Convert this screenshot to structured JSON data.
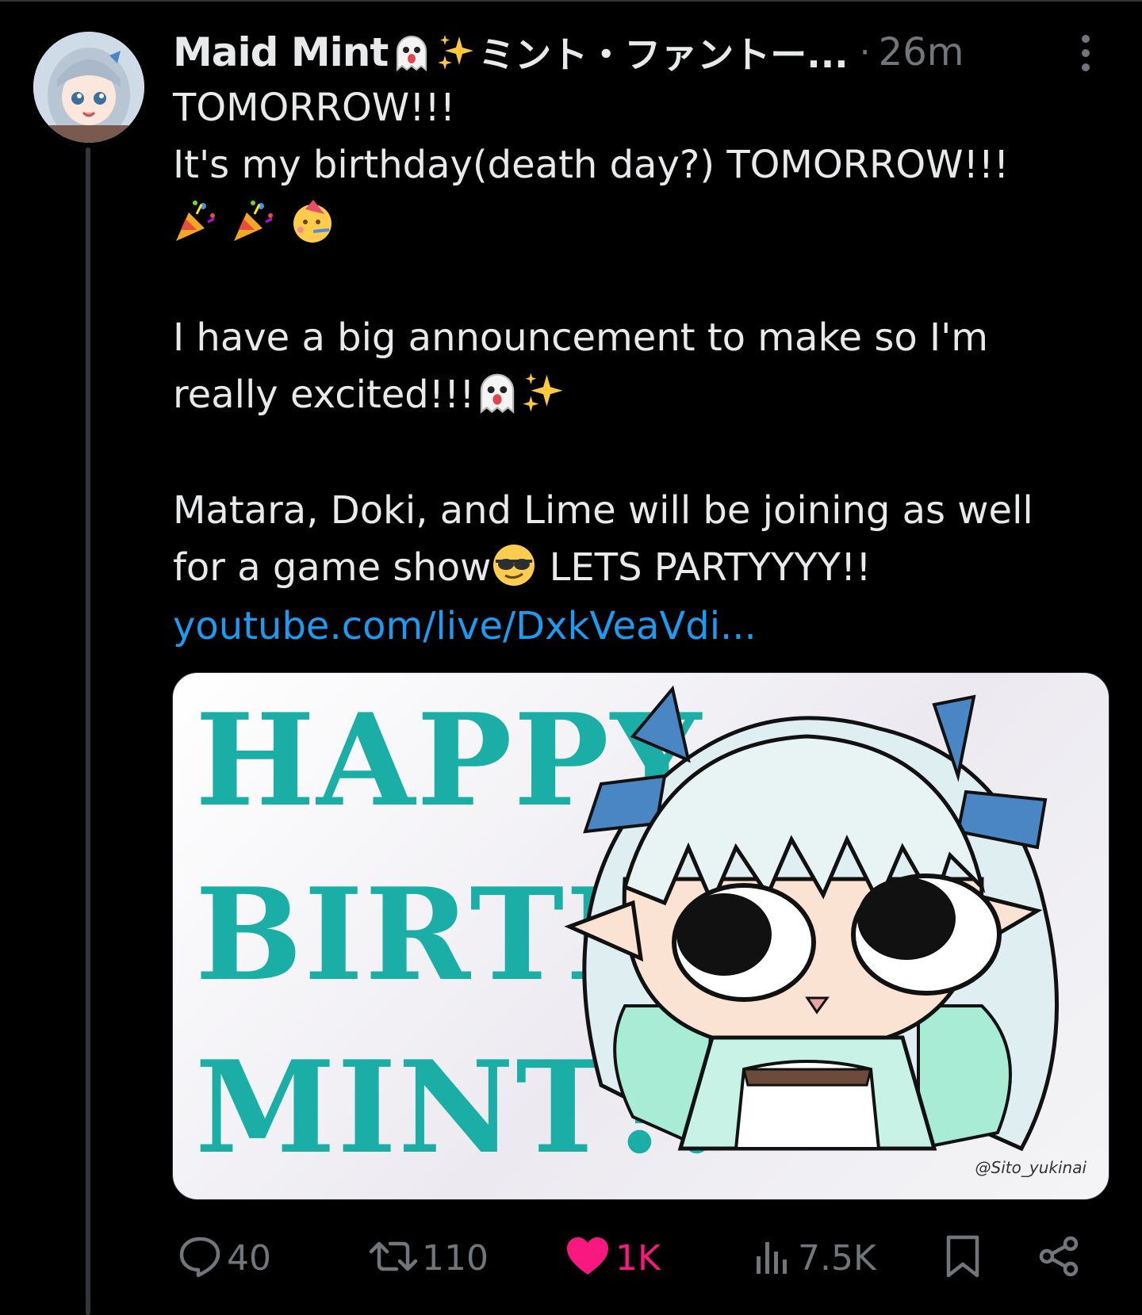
{
  "post": {
    "author_name": "Maid Mint",
    "author_name_jp": "ミント・ファントー...",
    "separator": "·",
    "time": "26m",
    "text_lines": [
      "TOMORROW!!!",
      "It's my birthday(death day?) TOMORROW!!!",
      "I have a big announcement to make so I'm",
      "really excited!!!",
      "Matara, Doki, and Lime will be joining as well",
      "for a game show",
      " LETS PARTYYYY!!"
    ],
    "link": "youtube.com/live/DxkVeaVdi...",
    "media": {
      "line1": "HAPPY",
      "line2": "BIRTH",
      "line3": "MINT!!",
      "watermark": "@Sito_yukinai"
    }
  },
  "actions": {
    "reply_count": "40",
    "repost_count": "110",
    "like_count": "1K",
    "views_count": "7.5K"
  },
  "colors": {
    "background": "#000000",
    "text": "#e7e9ea",
    "muted": "#71767b",
    "link": "#1d9bf0",
    "like": "#f91880",
    "media_text": "#1aaea6"
  }
}
